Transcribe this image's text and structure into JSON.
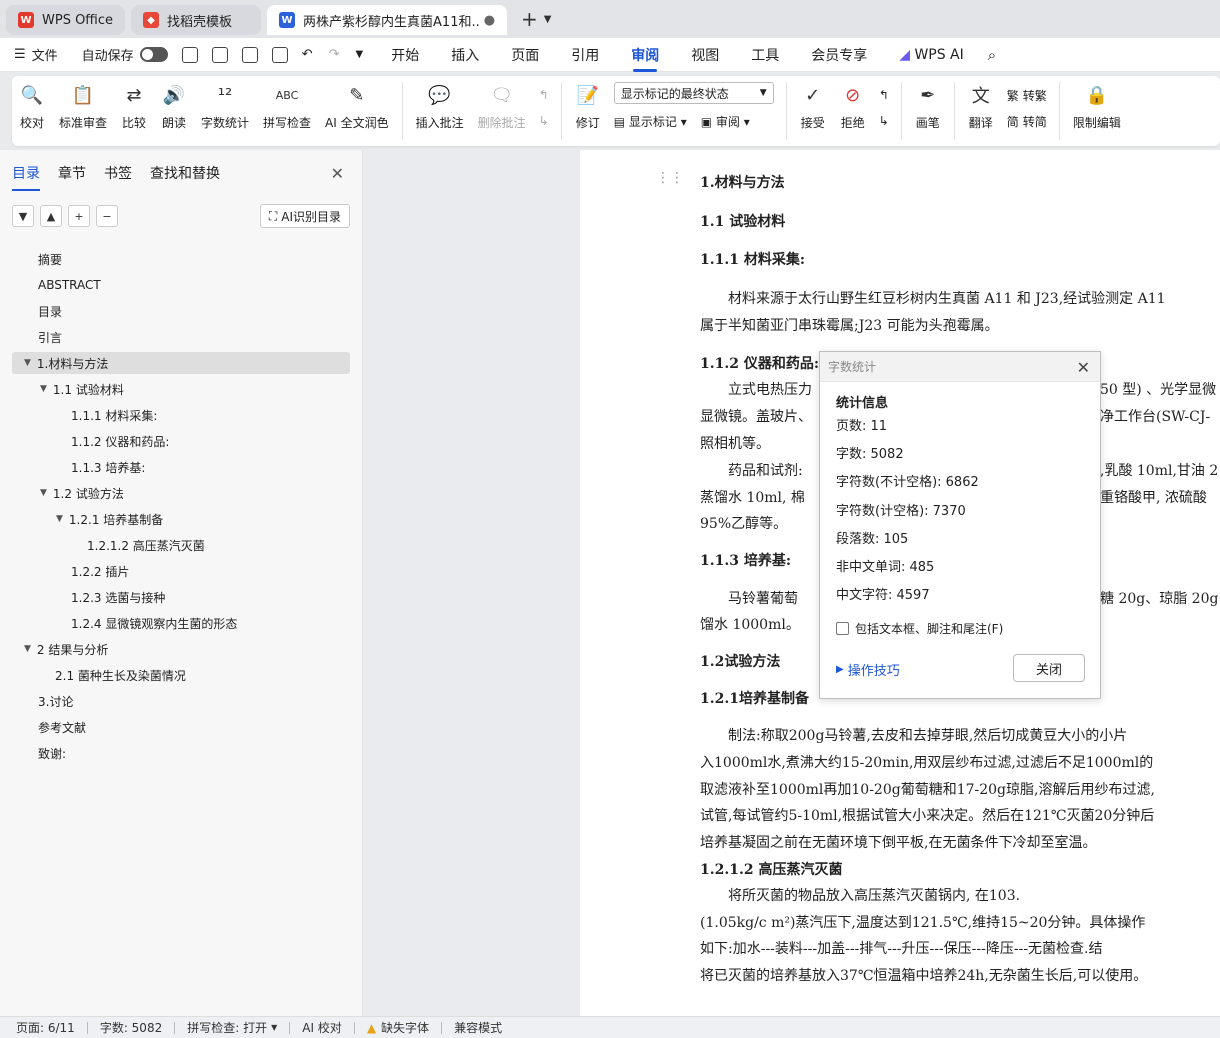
{
  "tabs": [
    {
      "label": "WPS Office",
      "icon": "wps-logo-icon"
    },
    {
      "label": "找稻壳模板",
      "icon": "docer-icon"
    },
    {
      "label": "两株产紫杉醇内生真菌A11和..",
      "icon": "word-doc-icon"
    }
  ],
  "menubar": {
    "file": "文件",
    "autosave": "自动保存",
    "tabs": [
      "开始",
      "插入",
      "页面",
      "引用",
      "审阅",
      "视图",
      "工具",
      "会员专享",
      "WPS AI"
    ],
    "active_tab": "审阅"
  },
  "ribbon": {
    "proofread": "校对",
    "standard_review": "标准审查",
    "compare": "比较",
    "read_aloud": "朗读",
    "word_count": "字数统计",
    "spell_check": "拼写检查",
    "ai_polish": "AI 全文润色",
    "insert_comment": "插入批注",
    "delete_comment": "删除批注",
    "track_changes": "修订",
    "markup_select": "显示标记的最终状态",
    "show_markup": "显示标记",
    "review": "审阅",
    "accept": "接受",
    "reject": "拒绝",
    "pen": "画笔",
    "translate": "翻译",
    "to_traditional": "转繁",
    "to_simplified": "转简",
    "restrict_edit": "限制编辑"
  },
  "sidebar": {
    "tabs": [
      "目录",
      "章节",
      "书签",
      "查找和替换"
    ],
    "ai_toc": "AI识别目录",
    "toc": [
      {
        "label": "摘要"
      },
      {
        "label": "ABSTRACT"
      },
      {
        "label": "目录"
      },
      {
        "label": "引言"
      },
      {
        "label": "1.材料与方法"
      },
      {
        "label": "1.1 试验材料"
      },
      {
        "label": "1.1.1 材料采集:"
      },
      {
        "label": "1.1.2 仪器和药品:"
      },
      {
        "label": "1.1.3  培养基:"
      },
      {
        "label": "1.2 试验方法"
      },
      {
        "label": "1.2.1 培养基制备"
      },
      {
        "label": "1.2.1.2  高压蒸汽灭菌"
      },
      {
        "label": "1.2.2  插片"
      },
      {
        "label": "1.2.3 选菌与接种"
      },
      {
        "label": "1.2.4  显微镜观察内生菌的形态"
      },
      {
        "label": "2 结果与分析"
      },
      {
        "label": "2.1  菌种生长及染菌情况"
      },
      {
        "label": "3.讨论"
      },
      {
        "label": "参考文献"
      },
      {
        "label": "致谢:"
      }
    ]
  },
  "document": {
    "lines": [
      "1.材料与方法",
      "1.1 试验材料",
      "1.1.1 材料采集:",
      "　　材料来源于太行山野生红豆杉树内生真菌 A11 和 J23,经试验测定 A11",
      "属于半知菌亚门串珠霉属;J23 可能为头孢霉属。",
      "1.1.2 仪器和药品:",
      "　　立式电热压力",
      "显微镜。盖玻片、",
      "照相机等。",
      "　　药品和试剂:",
      "蒸馏水 10ml, 棉",
      "95%乙醇等。",
      "1.1.3 培养基:",
      "　　马铃薯葡萄",
      "馏水 1000ml。",
      "1.2试验方法",
      "1.2.1培养基制备",
      "　　制法:称取200g马铃薯,去皮和去掉芽眼,然后切成黄豆大小的小片",
      "入1000ml水,煮沸大约15-20min,用双层纱布过滤,过滤后不足1000ml的",
      "取滤液补至1000ml再加10-20g葡萄糖和17-20g琼脂,溶解后用纱布过滤,",
      "试管,每试管约5-10ml,根据试管大小来决定。然后在121℃灭菌20分钟后",
      "培养基凝固之前在无菌环境下倒平板,在无菌条件下冷却至室温。",
      "1.2.1.2 高压蒸汽灭菌",
      "　　将所灭菌的物品放入高压蒸汽灭菌锅内, 在103.",
      "(1.05kg/c m²)蒸汽压下,温度达到121.5℃,维持15~20分钟。具体操作",
      "如下:加水---装料---加盖---排气---升压---保压---降压---无菌检查.结",
      "将已灭菌的培养基放入37℃恒温箱中培养24h,无杂菌生长后,可以使用。"
    ],
    "right_frags": {
      "instruments": "50 型) 、光学显微",
      "bench": "净工作台(SW-CJ-",
      "reagents": ",乳酸 10ml,甘油 2",
      "acid": "重铬酸甲, 浓硫酸",
      "medium": "糖 20g、琼脂 20g"
    }
  },
  "word_count_dialog": {
    "title": "字数统计",
    "heading": "统计信息",
    "rows": [
      "页数: 11",
      "字数: 5082",
      "字符数(不计空格): 6862",
      "字符数(计空格): 7370",
      "段落数: 105",
      "非中文单词: 485",
      "中文字符: 4597"
    ],
    "include_checkbox": "包括文本框、脚注和尾注(F)",
    "tips": "操作技巧",
    "close": "关闭"
  },
  "statusbar": {
    "page": "页面: 6/11",
    "words": "字数: 5082",
    "spell": "拼写检查: 打开",
    "ai_proof": "AI 校对",
    "missing_font": "缺失字体",
    "compat": "兼容模式"
  },
  "colors": {
    "accent": "#1d56d8",
    "wps_red": "#e23b2e",
    "word_blue": "#2b62d9"
  }
}
